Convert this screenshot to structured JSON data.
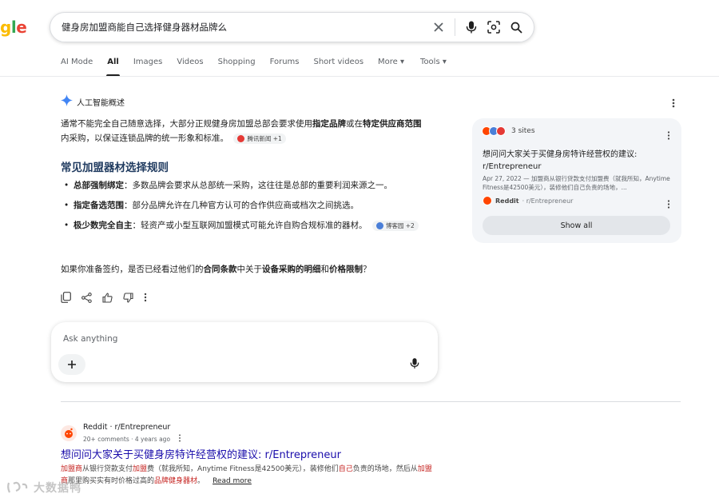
{
  "logo": {
    "part1": "g",
    "part2": "l",
    "part3": "e"
  },
  "search": {
    "query": "健身房加盟商能自己选择健身器材品牌么"
  },
  "tabs": [
    "AI Mode",
    "All",
    "Images",
    "Videos",
    "Shopping",
    "Forums",
    "Short videos",
    "More ▾",
    "Tools ▾"
  ],
  "ai_overview": {
    "label": "人工智能概述",
    "p1_a": "通常不能完全自己随意选择，大部分正规健身房加盟总部会要求使用",
    "p1_b": "指定品牌",
    "p1_c": "或在",
    "p1_d": "特定供应商范围",
    "p1_e": "内采购，以保证连锁品牌的统一形象和标准。",
    "chip1": "腾讯新闻 +1",
    "heading": "常见加盟器材选择规则",
    "bullets": [
      {
        "bold": "总部强制绑定",
        "text": "：多数品牌会要求从总部统一采购，这往往是总部的重要利润来源之一。"
      },
      {
        "bold": "指定备选范围",
        "text": "：部分品牌允许在几种官方认可的合作供应商或档次之间挑选。"
      },
      {
        "bold": "极少数完全自主",
        "text": "：轻资产或小型互联网加盟模式可能允许自购合规标准的器材。"
      }
    ],
    "chip2": "博客园 +2",
    "q_a": "如果你准备签约，是否已经看过他们的",
    "q_b": "合同条款",
    "q_c": "中关于",
    "q_d": "设备采购的明细",
    "q_e": "和",
    "q_f": "价格限制",
    "q_g": "？"
  },
  "sites_panel": {
    "count": "3 sites",
    "title": "想问问大家关于买健身房特许经营权的建议: r/Entrepreneur",
    "snippet": "Apr 27, 2022 — 加盟商从银行贷款支付加盟费（就我所知，Anytime Fitness是42500美元），装修他们自己负责的场地，...",
    "source_name": "Reddit",
    "source_sub": "· r/Entrepreneur",
    "show_all": "Show all"
  },
  "ask": {
    "placeholder": "Ask anything"
  },
  "result": {
    "site": "Reddit · r/Entrepreneur",
    "meta": "20+ comments · 4 years ago",
    "title": "想问问大家关于买健身房特许经营权的建议: r/Entrepreneur",
    "s1": "加盟商",
    "s2": "从银行贷款支付",
    "s3": "加盟",
    "s4": "费（就我所知，Anytime Fitness是42500美元），装修他们",
    "s5": "自己",
    "s6": "负责的场地，然后从",
    "s7": "加盟商",
    "s8": "那里购买实有时价格过高的",
    "s9": "品牌健身器材",
    "s10": "。",
    "read_more": "Read more"
  },
  "watermark": "大数据鸭",
  "colors": {
    "accent": "#1a0dab",
    "highlight": "#c5221f",
    "reddit": "#ff4500"
  }
}
